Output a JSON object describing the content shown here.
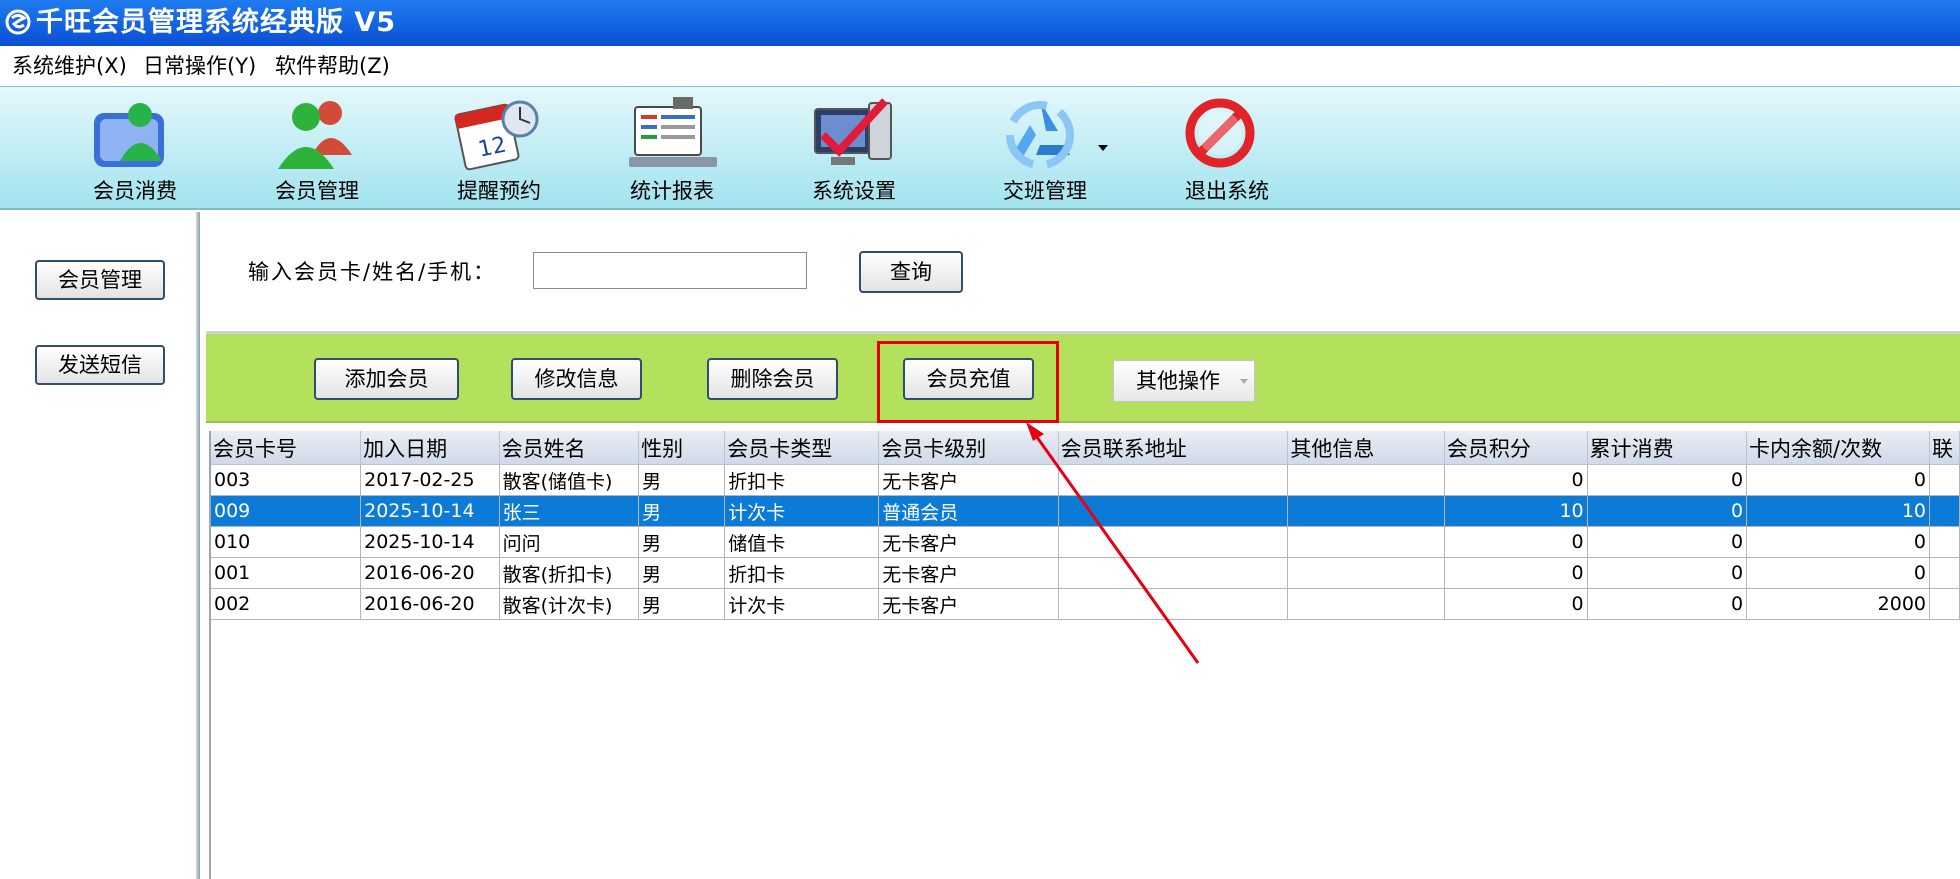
{
  "window": {
    "title": "千旺会员管理系统经典版 V5",
    "icon": "app-logo-icon"
  },
  "menu": [
    {
      "label": "系统维护(X)"
    },
    {
      "label": "日常操作(Y)"
    },
    {
      "label": "软件帮助(Z)"
    }
  ],
  "toolbar": [
    {
      "label": "会员消费",
      "icon": "member-consume-icon"
    },
    {
      "label": "会员管理",
      "icon": "member-manage-icon"
    },
    {
      "label": "提醒预约",
      "icon": "reminder-calendar-icon"
    },
    {
      "label": "统计报表",
      "icon": "report-icon"
    },
    {
      "label": "系统设置",
      "icon": "settings-icon"
    },
    {
      "label": "交班管理",
      "icon": "shift-recycle-icon"
    },
    {
      "label": "退出系统",
      "icon": "exit-icon"
    }
  ],
  "sidebar": [
    {
      "label": "会员管理"
    },
    {
      "label": "发送短信"
    }
  ],
  "search": {
    "label": "输入会员卡/姓名/手机：",
    "value": "",
    "button": "查询"
  },
  "actions": {
    "add": "添加会员",
    "edit": "修改信息",
    "delete": "删除会员",
    "recharge": "会员充值",
    "other": "其他操作"
  },
  "table": {
    "columns": [
      "会员卡号",
      "加入日期",
      "会员姓名",
      "性别",
      "会员卡类型",
      "会员卡级别",
      "会员联系地址",
      "其他信息",
      "会员积分",
      "累计消费",
      "卡内余额/次数",
      "联"
    ],
    "rows": [
      [
        "003",
        "2017-02-25",
        "散客(储值卡)",
        "男",
        "折扣卡",
        "无卡客户",
        "",
        "",
        "0",
        "0",
        "0",
        ""
      ],
      [
        "009",
        "2025-10-14",
        "张三",
        "男",
        "计次卡",
        "普通会员",
        "",
        "",
        "10",
        "0",
        "10",
        ""
      ],
      [
        "010",
        "2025-10-14",
        "问问",
        "男",
        "储值卡",
        "无卡客户",
        "",
        "",
        "0",
        "0",
        "0",
        ""
      ],
      [
        "001",
        "2016-06-20",
        "散客(折扣卡)",
        "男",
        "折扣卡",
        "无卡客户",
        "",
        "",
        "0",
        "0",
        "0",
        ""
      ],
      [
        "002",
        "2016-06-20",
        "散客(计次卡)",
        "男",
        "计次卡",
        "无卡客户",
        "",
        "",
        "0",
        "0",
        "2000",
        ""
      ]
    ],
    "selected_row": 1
  },
  "colors": {
    "annotation": "#e60012",
    "selection": "#0c7bd8",
    "action_bar": "#b3e15c",
    "title_bar": "#0a4fd3"
  }
}
